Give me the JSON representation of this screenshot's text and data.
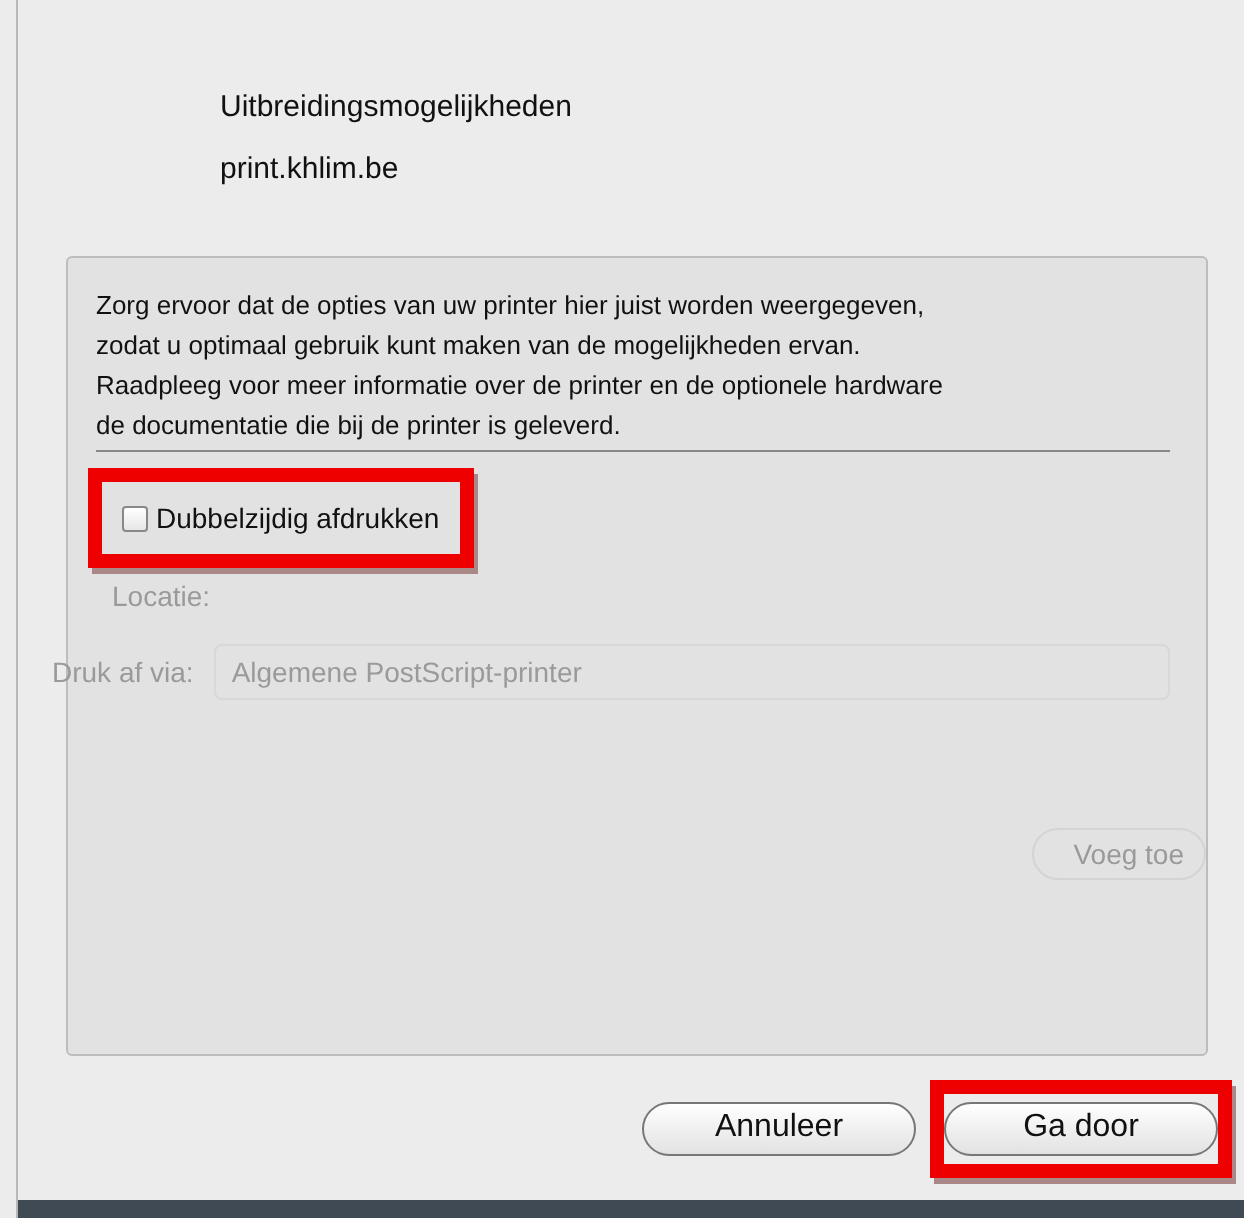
{
  "dialog": {
    "title": "Uitbreidingsmogelijkheden",
    "subtitle": "print.khlim.be",
    "message": "Zorg ervoor dat de opties van uw printer hier juist worden weergegeven,\nzodat u optimaal gebruik kunt maken van de mogelijkheden ervan.\nRaadpleeg voor meer informatie over de printer en de optionele hardware\nde documentatie die bij de printer is geleverd.",
    "options": [
      {
        "label": "Dubbelzijdig afdrukken",
        "checked": false,
        "highlighted": true
      }
    ],
    "background_form": {
      "location_label": "Locatie:",
      "driver_label": "Druk af via:",
      "driver_value": "Algemene PostScript-printer",
      "add_button": "Voeg toe"
    },
    "buttons": [
      {
        "label": "Annuleer",
        "highlighted": false
      },
      {
        "label": "Ga door",
        "highlighted": true
      }
    ]
  }
}
